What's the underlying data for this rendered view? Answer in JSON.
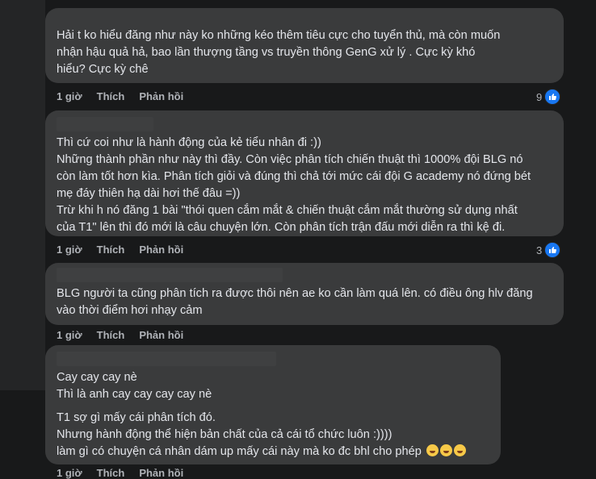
{
  "comments": [
    {
      "lines": [
        "Hải        t ko hiểu đăng như này ko những kéo thêm tiêu cực cho tuyển thủ, mà còn muốn",
        "nhận hậu quả hả, bao lần thượng tầng vs truyền thông GenG xử lý                 . Cực kỳ khó",
        "hiểu? Cực kỳ chê"
      ],
      "time": "1 giờ",
      "like": "Thích",
      "reply": "Phản hồi",
      "reaction_count": "9"
    },
    {
      "lines": [
        "Thì cứ coi như là hành động của kẻ tiểu nhân đi :))",
        "Những thành phần như này thì đầy. Còn việc phân tích chiến thuật thì 1000% đội BLG nó",
        "còn làm tốt hơn kìa. Phân tích giỏi và đúng thì chả tới mức cái đội G academy nó đứng bét",
        "mẹ đáy thiên hạ dài hơi thế đâu =))",
        "Trừ khi h nó đăng 1 bài \"thói quen cắm mắt & chiến thuật cắm mắt thường sử dụng nhất",
        "của T1\" lên thì đó mới là câu chuyện lớn. Còn phân tích trận đấu mới diễn ra thì kệ đi."
      ],
      "time": "1 giờ",
      "like": "Thích",
      "reply": "Phản hồi",
      "reaction_count": "3"
    },
    {
      "lines": [
        "BLG người ta cũng phân tích ra được thôi nên ae ko cần làm quá lên. có điều ông hlv đăng",
        "vào thời điểm hơi nhạy cảm"
      ],
      "time": "1 giờ",
      "like": "Thích",
      "reply": "Phản hồi"
    },
    {
      "lines": [
        "Cay cay cay nè",
        "Thì là anh cay cay cay cay nè",
        "",
        "T1 sợ gì mấy cái phân tích đó.",
        "Nhưng hành động thể hiện bản chất của cả cái tổ chức luôn :))))",
        "làm gì có chuyện cá nhân dám up mấy cái này mà ko đc bhl cho phép"
      ],
      "emoji": "rolling-on-floor-laughing-emoji",
      "time": "1 giờ",
      "like": "Thích",
      "reply": "Phản hồi"
    }
  ],
  "colors": {
    "bubble": "#3a3b3c",
    "background": "#18191a",
    "text": "#e4e6eb",
    "muted": "#b0b3b8",
    "like": "#1877f2"
  }
}
